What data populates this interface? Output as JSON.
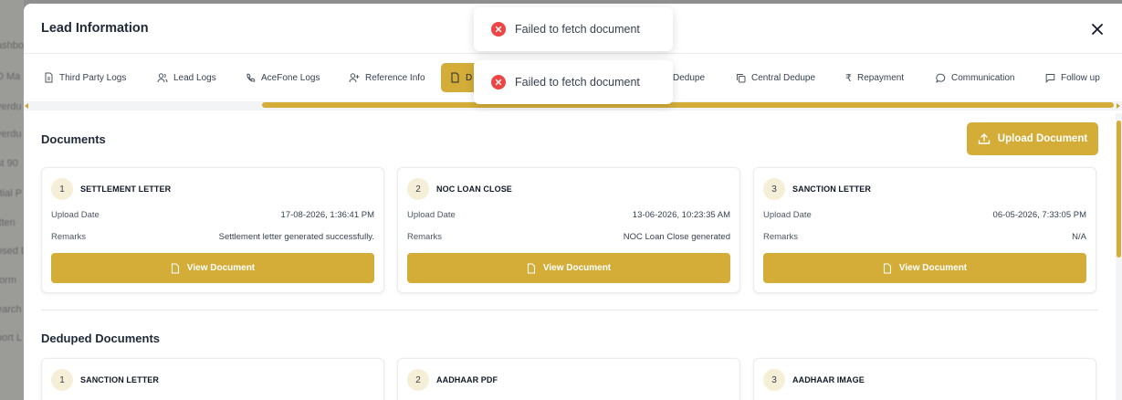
{
  "background": {
    "sidebar_fragments": [
      "ashbo",
      "D Ma",
      "verdu",
      "verdu",
      "st 90",
      "rtial P",
      "itten",
      "osed L",
      "form",
      "earch",
      "port L"
    ]
  },
  "modal": {
    "title": "Lead Information",
    "close_icon": "close-icon"
  },
  "tabs": [
    {
      "label": "Third Party Logs",
      "icon": "document-icon"
    },
    {
      "label": "Lead Logs",
      "icon": "users-icon"
    },
    {
      "label": "AceFone Logs",
      "icon": "phone-icon"
    },
    {
      "label": "Reference Info",
      "icon": "user-plus-icon"
    },
    {
      "label": "D",
      "icon": "document-icon",
      "active": true
    },
    {
      "label": "Dedupe",
      "icon": ""
    },
    {
      "label": "Central Dedupe",
      "icon": "copy-icon"
    },
    {
      "label": "Repayment",
      "icon": "rupee-icon"
    },
    {
      "label": "Communication",
      "icon": "chat-icon"
    },
    {
      "label": "Follow up",
      "icon": "message-square-icon"
    }
  ],
  "toasts": [
    {
      "message": "Failed to fetch document",
      "icon": "error-icon"
    },
    {
      "message": "Failed to fetch document",
      "icon": "error-icon"
    }
  ],
  "documents": {
    "title": "Documents",
    "upload_label": "Upload Document",
    "upload_date_label": "Upload Date",
    "remarks_label": "Remarks",
    "view_label": "View Document",
    "items": [
      {
        "index": "1",
        "name": "SETTLEMENT LETTER",
        "upload_date": "17-08-2026, 1:36:41 PM",
        "remarks": "Settlement letter generated successfully."
      },
      {
        "index": "2",
        "name": "NOC LOAN CLOSE",
        "upload_date": "13-06-2026, 10:23:35 AM",
        "remarks": "NOC Loan Close generated"
      },
      {
        "index": "3",
        "name": "SANCTION LETTER",
        "upload_date": "06-05-2026, 7:33:05 PM",
        "remarks": "N/A"
      }
    ]
  },
  "deduped_documents": {
    "title": "Deduped Documents",
    "items": [
      {
        "index": "1",
        "name": "SANCTION LETTER"
      },
      {
        "index": "2",
        "name": "AADHAAR PDF"
      },
      {
        "index": "3",
        "name": "AADHAAR IMAGE"
      }
    ]
  },
  "colors": {
    "accent": "#d4ad38",
    "error": "#ef4444",
    "badge_bg": "#f6efd8"
  }
}
